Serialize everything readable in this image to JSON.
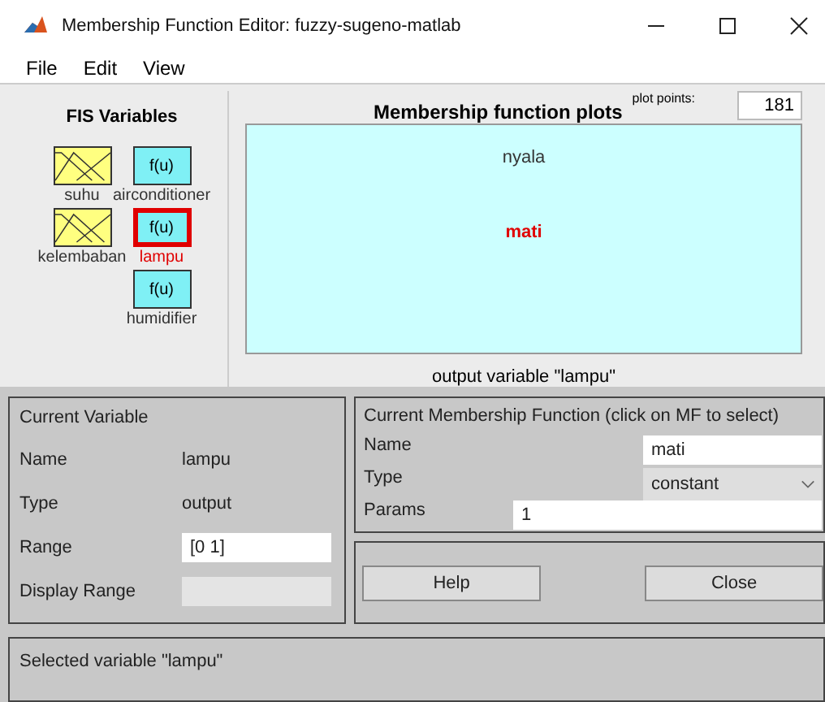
{
  "window": {
    "title": "Membership Function Editor: fuzzy-sugeno-matlab"
  },
  "menu": [
    "File",
    "Edit",
    "View"
  ],
  "fis_variables": {
    "title": "FIS Variables",
    "items": [
      {
        "name": "suhu",
        "kind": "input",
        "selected": false
      },
      {
        "name": "airconditioner",
        "kind": "output",
        "glyph": "f(u)",
        "selected": false
      },
      {
        "name": "kelembaban",
        "kind": "input",
        "selected": false
      },
      {
        "name": "lampu",
        "kind": "output",
        "glyph": "f(u)",
        "selected": true
      },
      {
        "name": "humidifier",
        "kind": "output",
        "glyph": "f(u)",
        "selected": false
      }
    ]
  },
  "plot": {
    "title": "Membership function plots",
    "plot_points_label": "plot points:",
    "plot_points": "181",
    "mfs": [
      {
        "name": "nyala",
        "selected": false
      },
      {
        "name": "mati",
        "selected": true
      }
    ],
    "caption": "output variable \"lampu\""
  },
  "current_variable": {
    "title": "Current Variable",
    "name_label": "Name",
    "name": "lampu",
    "type_label": "Type",
    "type": "output",
    "range_label": "Range",
    "range": "[0 1]",
    "display_range_label": "Display Range"
  },
  "current_mf": {
    "title": "Current Membership Function (click on MF to select)",
    "name_label": "Name",
    "name": "mati",
    "type_label": "Type",
    "type": "constant",
    "params_label": "Params",
    "params": "1"
  },
  "buttons": [
    "Help",
    "Close"
  ],
  "status": "Selected variable \"lampu\""
}
